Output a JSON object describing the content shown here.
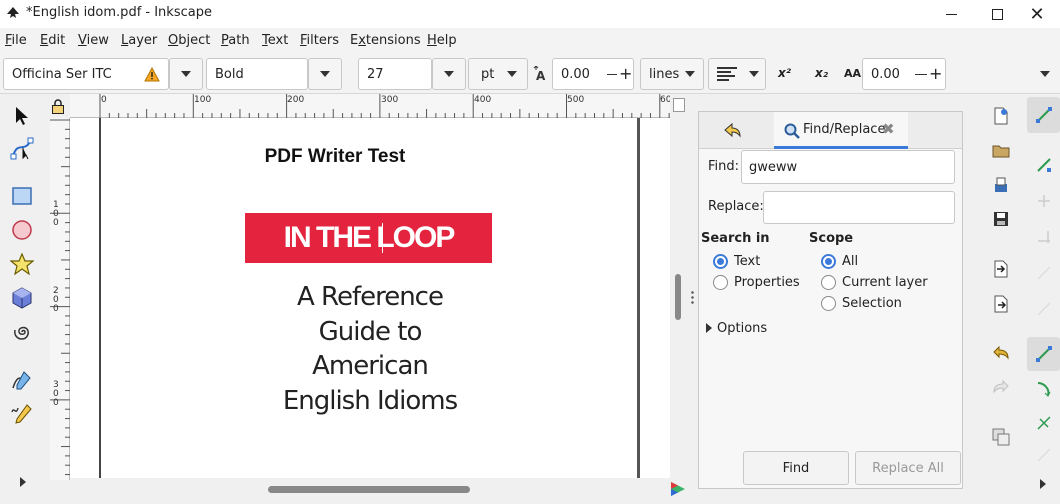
{
  "window": {
    "title": "*English idom.pdf - Inkscape",
    "minimize_icon": "minimize-icon",
    "maximize_icon": "maximize-icon",
    "close_icon": "close-icon"
  },
  "menubar": {
    "items": [
      {
        "label": "File",
        "underline": "F",
        "rest": "ile"
      },
      {
        "label": "Edit",
        "underline": "E",
        "rest": "dit"
      },
      {
        "label": "View",
        "underline": "V",
        "rest": "iew"
      },
      {
        "label": "Layer",
        "underline": "L",
        "rest": "ayer"
      },
      {
        "label": "Object",
        "underline": "O",
        "rest": "bject"
      },
      {
        "label": "Path",
        "underline": "P",
        "rest": "ath"
      },
      {
        "label": "Text",
        "underline": "T",
        "rest": "ext"
      },
      {
        "label": "Filters",
        "underline": "F",
        "rest": "ilters",
        "prefix": ""
      },
      {
        "label": "Extensions",
        "underline": "x",
        "rest": "tensions",
        "prefix": "E"
      },
      {
        "label": "Help",
        "underline": "H",
        "rest": "elp"
      }
    ]
  },
  "textbar": {
    "font_family": "Officina Ser ITC",
    "font_style": "Bold",
    "font_size": "27",
    "unit": "pt",
    "line_spacing": "0.00",
    "spacing_mode": "lines",
    "letter_spacing": "0.00",
    "superscript": "x²",
    "subscript": "x₂",
    "caps": "AA"
  },
  "ruler": {
    "top_ticks": [
      "0",
      "100",
      "200",
      "300",
      "400",
      "500",
      "60"
    ],
    "left_ticks": [
      "1",
      "0",
      "0",
      "2",
      "0",
      "0",
      "3",
      "0",
      "0",
      "4",
      "0",
      "0",
      "5",
      "0",
      "0",
      "6",
      "0",
      "0"
    ]
  },
  "document": {
    "heading": "PDF Writer Test",
    "banner_text": "IN THE LOOP",
    "banner_color": "#e4243e",
    "body_lines": [
      "A Reference",
      "Guide to",
      "American",
      "English Idioms"
    ]
  },
  "find_replace": {
    "tab_label": "Find/Replace",
    "find_label": "Find:",
    "find_value": "gweww",
    "replace_label": "Replace:",
    "replace_value": "",
    "search_in_heading": "Search in",
    "search_text": "Text",
    "search_properties": "Properties",
    "scope_heading": "Scope",
    "scope_all": "All",
    "scope_current_layer": "Current layer",
    "scope_selection": "Selection",
    "options_label": "Options",
    "find_button": "Find",
    "replace_all_button": "Replace All"
  },
  "colors": {
    "accent": "#3b7ad9",
    "banner": "#e4243e"
  }
}
